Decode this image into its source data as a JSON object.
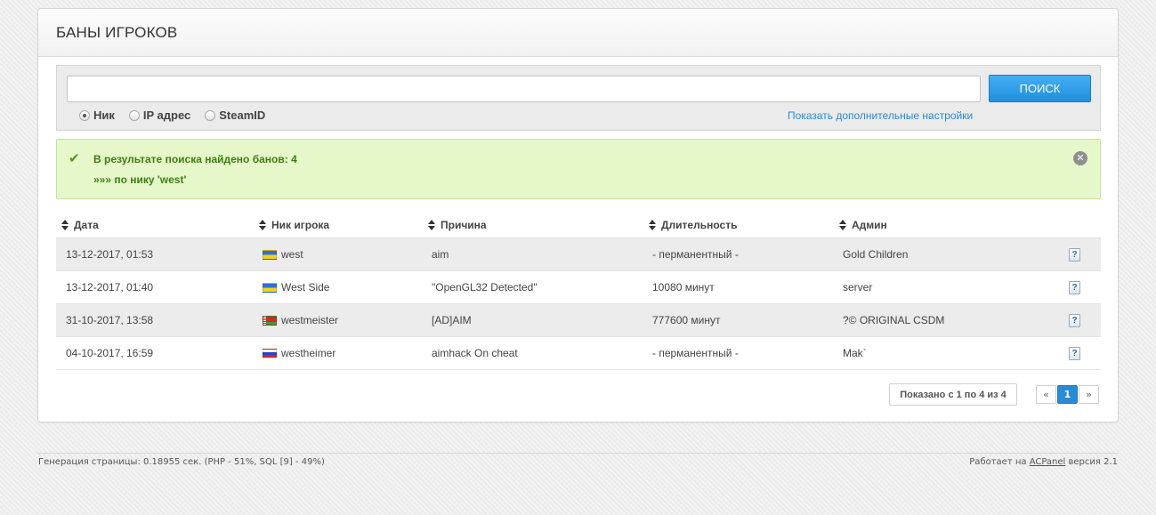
{
  "panel": {
    "title": "БАНЫ ИГРОКОВ"
  },
  "search": {
    "value": "",
    "placeholder": "",
    "button_label": "ПОИСК",
    "options": [
      {
        "label": "Ник",
        "checked": true
      },
      {
        "label": "IP адрес",
        "checked": false
      },
      {
        "label": "SteamID",
        "checked": false
      }
    ],
    "more_settings_link": "Показать дополнительные настройки"
  },
  "alert": {
    "line1": "В результате поиска найдено банов: 4",
    "line2": "»»» по нику 'west'"
  },
  "table": {
    "headers": [
      "Дата",
      "Ник игрока",
      "Причина",
      "Длительность",
      "Админ"
    ],
    "rows": [
      {
        "date": "13-12-2017, 01:53",
        "flag": "ua",
        "nick": "west",
        "reason": "aim",
        "duration": "- перманентный -",
        "admin": "Gold Children"
      },
      {
        "date": "13-12-2017, 01:40",
        "flag": "ua",
        "nick": "West Side",
        "reason": "\"OpenGL32 Detected\"",
        "duration": "10080 минут",
        "admin": "server"
      },
      {
        "date": "31-10-2017, 13:58",
        "flag": "by",
        "nick": "westmeister",
        "reason": "[AD]AIM",
        "duration": "777600 минут",
        "admin": "?© ORIGINAL CSDM"
      },
      {
        "date": "04-10-2017, 16:59",
        "flag": "ru",
        "nick": "westheimer",
        "reason": "aimhack On cheat",
        "duration": "- перманентный -",
        "admin": "Mak`"
      }
    ]
  },
  "pagination": {
    "summary": "Показано с 1 по 4 из 4",
    "prev": "«",
    "current": "1",
    "next": "»"
  },
  "footer": {
    "left": "Генерация страницы: 0.18955 сек. (PHP - 51%, SQL [9] - 49%)",
    "right_prefix": "Работает на",
    "right_link": "ACPanel",
    "right_suffix": "версия 2.1"
  }
}
